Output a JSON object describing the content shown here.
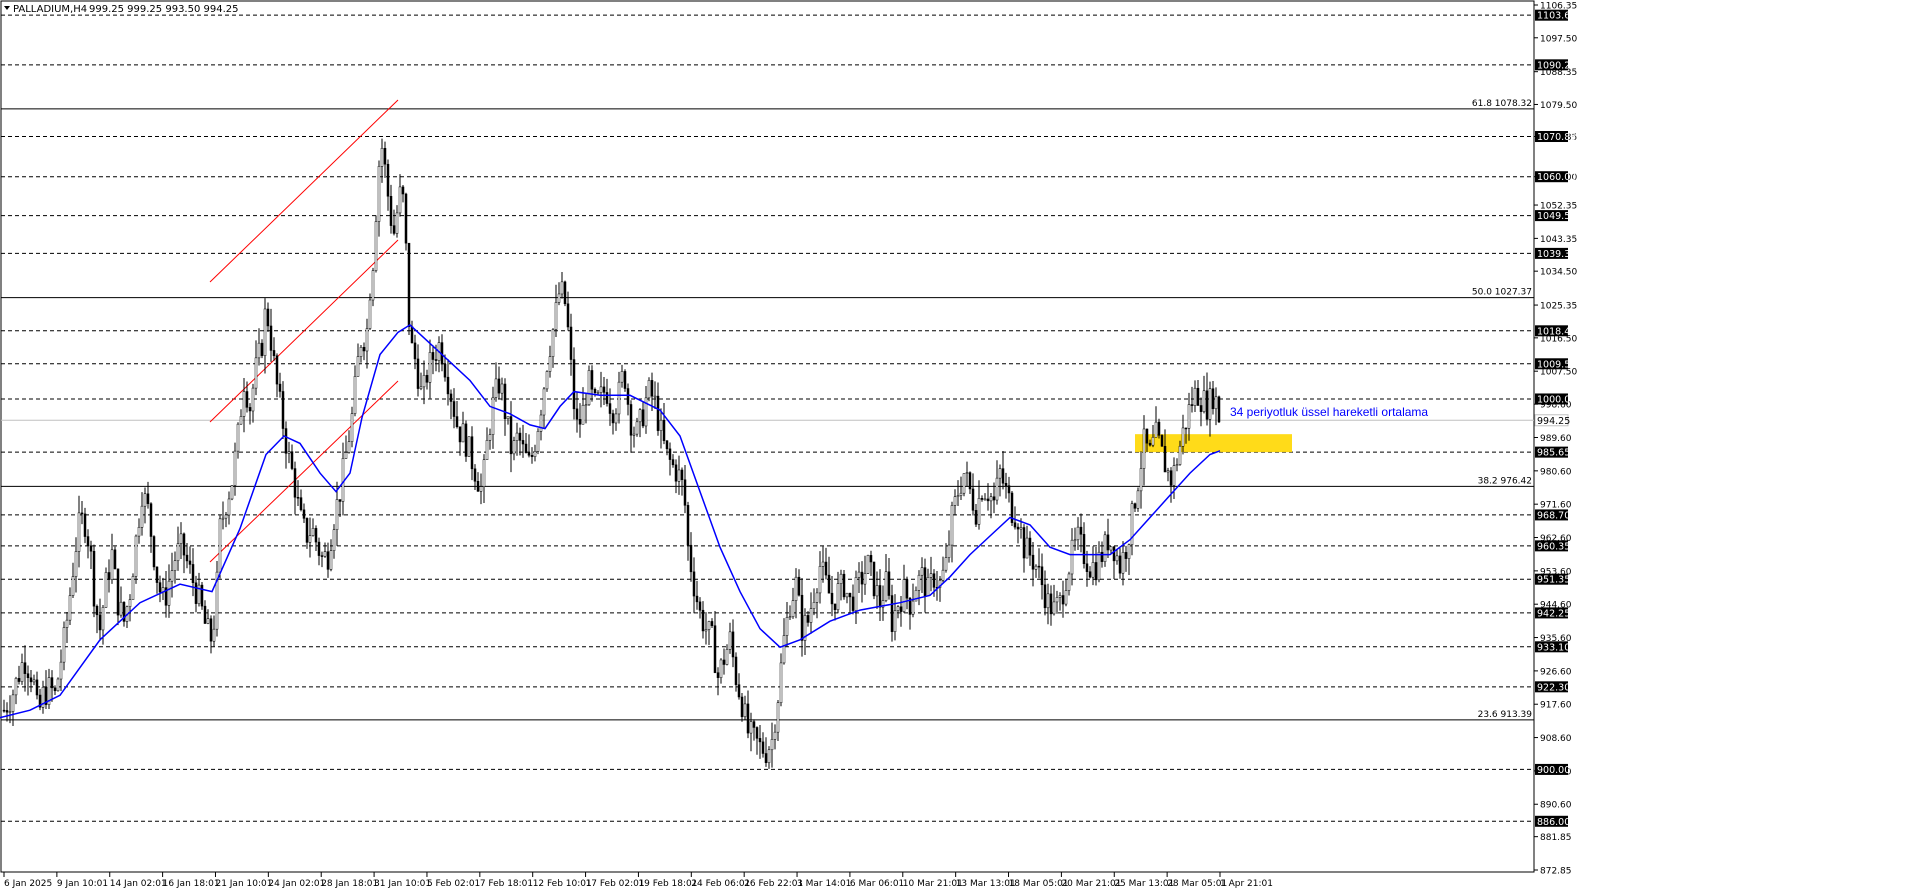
{
  "header": {
    "symbol": "PALLADIUM,H4",
    "ohlc": "999.25 999.25 993.50 994.25"
  },
  "colors": {
    "ema": "#0000ff",
    "channel": "#ff0000",
    "candle": "#000000",
    "zone": "#ffd700",
    "price_line": "#c0c0c0",
    "label_bg": "#000000",
    "label_fg": "#ffffff"
  },
  "chart_data": {
    "type": "candlestick",
    "title": "PALLADIUM,H4",
    "ylim": [
      872.85,
      1106.35
    ],
    "y_tick_labels": [
      "1106.35",
      "1097.50",
      "1088.35",
      "1079.50",
      "1070.85",
      "1060.00",
      "1052.35",
      "1043.35",
      "1034.50",
      "1025.35",
      "1016.50",
      "1007.50",
      "998.60",
      "989.60",
      "980.60",
      "971.60",
      "962.60",
      "953.60",
      "944.60",
      "935.60",
      "926.60",
      "917.60",
      "908.60",
      "899.60",
      "890.60",
      "881.85",
      "872.85"
    ],
    "x_tick_labels": [
      "6 Jan 2025",
      "9 Jan 10:01",
      "14 Jan 02:01",
      "16 Jan 18:01",
      "21 Jan 10:01",
      "24 Jan 02:01",
      "28 Jan 18:01",
      "31 Jan 10:01",
      "5 Feb 02:01",
      "7 Feb 18:01",
      "12 Feb 10:01",
      "17 Feb 02:01",
      "19 Feb 18:01",
      "24 Feb 06:01",
      "26 Feb 22:01",
      "3 Mar 14:01",
      "6 Mar 06:01",
      "10 Mar 21:01",
      "13 Mar 13:01",
      "18 Mar 05:01",
      "20 Mar 21:01",
      "25 Mar 13:01",
      "28 Mar 05:01",
      "1 Apr 21:01"
    ],
    "horizontal_levels": [
      1103.6,
      1090.2,
      1070.85,
      1060.0,
      1049.5,
      1039.3,
      1018.4,
      1009.5,
      1000.0,
      985.65,
      968.7,
      960.35,
      951.35,
      942.25,
      933.1,
      922.3,
      900.0,
      886.0
    ],
    "current_price": 994.25,
    "fibonacci": [
      {
        "label": "61.8 1078.32",
        "value": 1078.32
      },
      {
        "label": "50.0 1027.37",
        "value": 1027.37
      },
      {
        "label": "38.2 976.42",
        "value": 976.42
      },
      {
        "label": "23.6 913.39",
        "value": 913.39
      }
    ],
    "support_zone": [
      985.65,
      990.5
    ],
    "annotation": "34 periyotluk üssel hareketli ortalama",
    "price_path": [
      [
        0,
        914
      ],
      [
        12,
        920
      ],
      [
        24,
        930
      ],
      [
        33,
        925
      ],
      [
        38,
        914
      ],
      [
        43,
        920
      ],
      [
        50,
        922
      ],
      [
        55,
        920
      ],
      [
        60,
        928
      ],
      [
        66,
        938
      ],
      [
        72,
        952
      ],
      [
        78,
        965
      ],
      [
        84,
        968
      ],
      [
        90,
        960
      ],
      [
        95,
        945
      ],
      [
        100,
        938
      ],
      [
        106,
        950
      ],
      [
        112,
        958
      ],
      [
        118,
        945
      ],
      [
        124,
        940
      ],
      [
        130,
        948
      ],
      [
        136,
        962
      ],
      [
        142,
        975
      ],
      [
        148,
        970
      ],
      [
        153,
        960
      ],
      [
        158,
        950
      ],
      [
        164,
        945
      ],
      [
        170,
        952
      ],
      [
        176,
        958
      ],
      [
        182,
        960
      ],
      [
        188,
        955
      ],
      [
        194,
        950
      ],
      [
        200,
        945
      ],
      [
        206,
        938
      ],
      [
        212,
        935
      ],
      [
        216,
        945
      ],
      [
        220,
        965
      ],
      [
        226,
        972
      ],
      [
        232,
        978
      ],
      [
        238,
        990
      ],
      [
        244,
        1005
      ],
      [
        250,
        998
      ],
      [
        256,
        1008
      ],
      [
        262,
        1015
      ],
      [
        266,
        1025
      ],
      [
        270,
        1018
      ],
      [
        276,
        1005
      ],
      [
        282,
        995
      ],
      [
        288,
        985
      ],
      [
        294,
        978
      ],
      [
        300,
        968
      ],
      [
        306,
        963
      ],
      [
        312,
        965
      ],
      [
        318,
        960
      ],
      [
        322,
        957
      ],
      [
        328,
        958
      ],
      [
        334,
        968
      ],
      [
        340,
        975
      ],
      [
        346,
        985
      ],
      [
        352,
        995
      ],
      [
        358,
        1010
      ],
      [
        362,
        1018
      ],
      [
        366,
        1015
      ],
      [
        370,
        1030
      ],
      [
        374,
        1040
      ],
      [
        378,
        1062
      ],
      [
        382,
        1068
      ],
      [
        386,
        1060
      ],
      [
        390,
        1050
      ],
      [
        394,
        1045
      ],
      [
        398,
        1052
      ],
      [
        402,
        1058
      ],
      [
        406,
        1040
      ],
      [
        410,
        1015
      ],
      [
        416,
        1010
      ],
      [
        422,
        1000
      ],
      [
        428,
        1008
      ],
      [
        434,
        1012
      ],
      [
        440,
        1015
      ],
      [
        446,
        1008
      ],
      [
        452,
        1000
      ],
      [
        458,
        992
      ],
      [
        464,
        990
      ],
      [
        470,
        985
      ],
      [
        476,
        980
      ],
      [
        482,
        975
      ],
      [
        488,
        990
      ],
      [
        494,
        1000
      ],
      [
        500,
        1005
      ],
      [
        506,
        995
      ],
      [
        512,
        985
      ],
      [
        518,
        990
      ],
      [
        524,
        985
      ],
      [
        530,
        982
      ],
      [
        536,
        990
      ],
      [
        542,
        1000
      ],
      [
        548,
        1012
      ],
      [
        554,
        1020
      ],
      [
        560,
        1030
      ],
      [
        566,
        1025
      ],
      [
        572,
        1005
      ],
      [
        576,
        992
      ],
      [
        582,
        995
      ],
      [
        588,
        1005
      ],
      [
        594,
        998
      ],
      [
        600,
        1000
      ],
      [
        606,
        1003
      ],
      [
        612,
        997
      ],
      [
        618,
        1000
      ],
      [
        624,
        1008
      ],
      [
        630,
        995
      ],
      [
        636,
        990
      ],
      [
        642,
        995
      ],
      [
        648,
        1002
      ],
      [
        654,
        1000
      ],
      [
        660,
        992
      ],
      [
        666,
        985
      ],
      [
        672,
        982
      ],
      [
        678,
        980
      ],
      [
        684,
        975
      ],
      [
        688,
        960
      ],
      [
        694,
        950
      ],
      [
        700,
        942
      ],
      [
        706,
        938
      ],
      [
        712,
        935
      ],
      [
        718,
        925
      ],
      [
        724,
        930
      ],
      [
        730,
        935
      ],
      [
        736,
        925
      ],
      [
        742,
        918
      ],
      [
        748,
        910
      ],
      [
        754,
        908
      ],
      [
        760,
        906
      ],
      [
        766,
        905
      ],
      [
        772,
        908
      ],
      [
        778,
        920
      ],
      [
        784,
        935
      ],
      [
        790,
        945
      ],
      [
        796,
        950
      ],
      [
        802,
        938
      ],
      [
        808,
        940
      ],
      [
        814,
        948
      ],
      [
        820,
        955
      ],
      [
        826,
        950
      ],
      [
        832,
        945
      ],
      [
        838,
        948
      ],
      [
        844,
        950
      ],
      [
        850,
        945
      ],
      [
        856,
        948
      ],
      [
        862,
        952
      ],
      [
        868,
        955
      ],
      [
        874,
        950
      ],
      [
        880,
        945
      ],
      [
        886,
        950
      ],
      [
        892,
        940
      ],
      [
        898,
        945
      ],
      [
        904,
        948
      ],
      [
        910,
        945
      ],
      [
        916,
        950
      ],
      [
        922,
        952
      ],
      [
        928,
        948
      ],
      [
        934,
        952
      ],
      [
        940,
        950
      ],
      [
        946,
        955
      ],
      [
        952,
        968
      ],
      [
        958,
        975
      ],
      [
        964,
        980
      ],
      [
        970,
        975
      ],
      [
        976,
        970
      ],
      [
        982,
        976
      ],
      [
        988,
        975
      ],
      [
        994,
        972
      ],
      [
        1000,
        980
      ],
      [
        1006,
        975
      ],
      [
        1012,
        970
      ],
      [
        1018,
        968
      ],
      [
        1024,
        960
      ],
      [
        1030,
        958
      ],
      [
        1036,
        955
      ],
      [
        1042,
        950
      ],
      [
        1048,
        945
      ],
      [
        1054,
        943
      ],
      [
        1060,
        945
      ],
      [
        1066,
        952
      ],
      [
        1072,
        958
      ],
      [
        1078,
        962
      ],
      [
        1084,
        958
      ],
      [
        1090,
        955
      ],
      [
        1096,
        955
      ],
      [
        1102,
        958
      ],
      [
        1108,
        962
      ],
      [
        1114,
        960
      ],
      [
        1120,
        955
      ],
      [
        1126,
        960
      ],
      [
        1132,
        968
      ],
      [
        1138,
        978
      ],
      [
        1144,
        988
      ],
      [
        1150,
        985
      ],
      [
        1156,
        990
      ],
      [
        1162,
        985
      ],
      [
        1168,
        980
      ],
      [
        1172,
        978
      ],
      [
        1178,
        985
      ],
      [
        1184,
        992
      ],
      [
        1190,
        998
      ],
      [
        1196,
        1002
      ],
      [
        1202,
        1000
      ],
      [
        1208,
        998
      ],
      [
        1214,
        1002
      ],
      [
        1220,
        994
      ]
    ],
    "ema34": [
      [
        0,
        914
      ],
      [
        30,
        916
      ],
      [
        60,
        920
      ],
      [
        100,
        935
      ],
      [
        140,
        945
      ],
      [
        180,
        950
      ],
      [
        212,
        948
      ],
      [
        240,
        965
      ],
      [
        266,
        985
      ],
      [
        284,
        990
      ],
      [
        300,
        988
      ],
      [
        320,
        980
      ],
      [
        336,
        975
      ],
      [
        350,
        980
      ],
      [
        362,
        995
      ],
      [
        380,
        1012
      ],
      [
        398,
        1018
      ],
      [
        410,
        1020
      ],
      [
        430,
        1015
      ],
      [
        450,
        1010
      ],
      [
        470,
        1005
      ],
      [
        490,
        998
      ],
      [
        510,
        996
      ],
      [
        530,
        993
      ],
      [
        545,
        992
      ],
      [
        560,
        998
      ],
      [
        574,
        1002
      ],
      [
        600,
        1001
      ],
      [
        630,
        1001
      ],
      [
        660,
        997
      ],
      [
        680,
        990
      ],
      [
        700,
        975
      ],
      [
        720,
        960
      ],
      [
        740,
        948
      ],
      [
        760,
        938
      ],
      [
        780,
        933
      ],
      [
        800,
        935
      ],
      [
        830,
        940
      ],
      [
        860,
        943
      ],
      [
        880,
        944
      ],
      [
        900,
        945
      ],
      [
        930,
        947
      ],
      [
        950,
        952
      ],
      [
        970,
        958
      ],
      [
        990,
        963
      ],
      [
        1010,
        968
      ],
      [
        1030,
        966
      ],
      [
        1050,
        960
      ],
      [
        1070,
        958
      ],
      [
        1090,
        958
      ],
      [
        1110,
        958
      ],
      [
        1130,
        962
      ],
      [
        1150,
        968
      ],
      [
        1170,
        974
      ],
      [
        1190,
        980
      ],
      [
        1210,
        985
      ],
      [
        1220,
        986
      ]
    ]
  }
}
